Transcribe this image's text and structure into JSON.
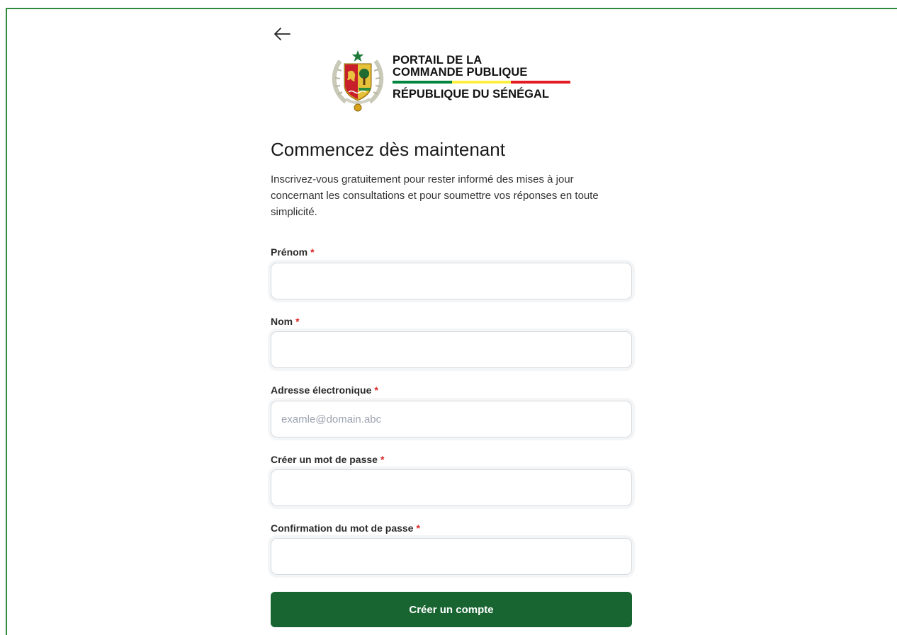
{
  "header": {
    "back_icon": "arrow-left-icon",
    "brand_line1": "PORTAIL DE LA",
    "brand_line2": "COMMANDE PUBLIQUE",
    "brand_line3": "RÉPUBLIQUE DU SÉNÉGAL",
    "flag_colors": [
      "#00853f",
      "#fdef42",
      "#e31b23"
    ]
  },
  "form": {
    "title": "Commencez dès maintenant",
    "intro": "Inscrivez-vous gratuitement pour rester informé des mises à jour concernant les consultations et pour soumettre vos réponses en toute simplicité.",
    "required_marker": "*",
    "fields": [
      {
        "label": "Prénom",
        "value": "",
        "placeholder": ""
      },
      {
        "label": "Nom",
        "value": "",
        "placeholder": ""
      },
      {
        "label": "Adresse électronique",
        "value": "",
        "placeholder": "examle@domain.abc"
      },
      {
        "label": "Créer un mot de passe",
        "value": "",
        "placeholder": ""
      },
      {
        "label": "Confirmation du mot de passe",
        "value": "",
        "placeholder": ""
      }
    ],
    "submit_label": "Créer un compte",
    "submit_color": "#186532"
  },
  "frame_color": "#2e8b3d"
}
